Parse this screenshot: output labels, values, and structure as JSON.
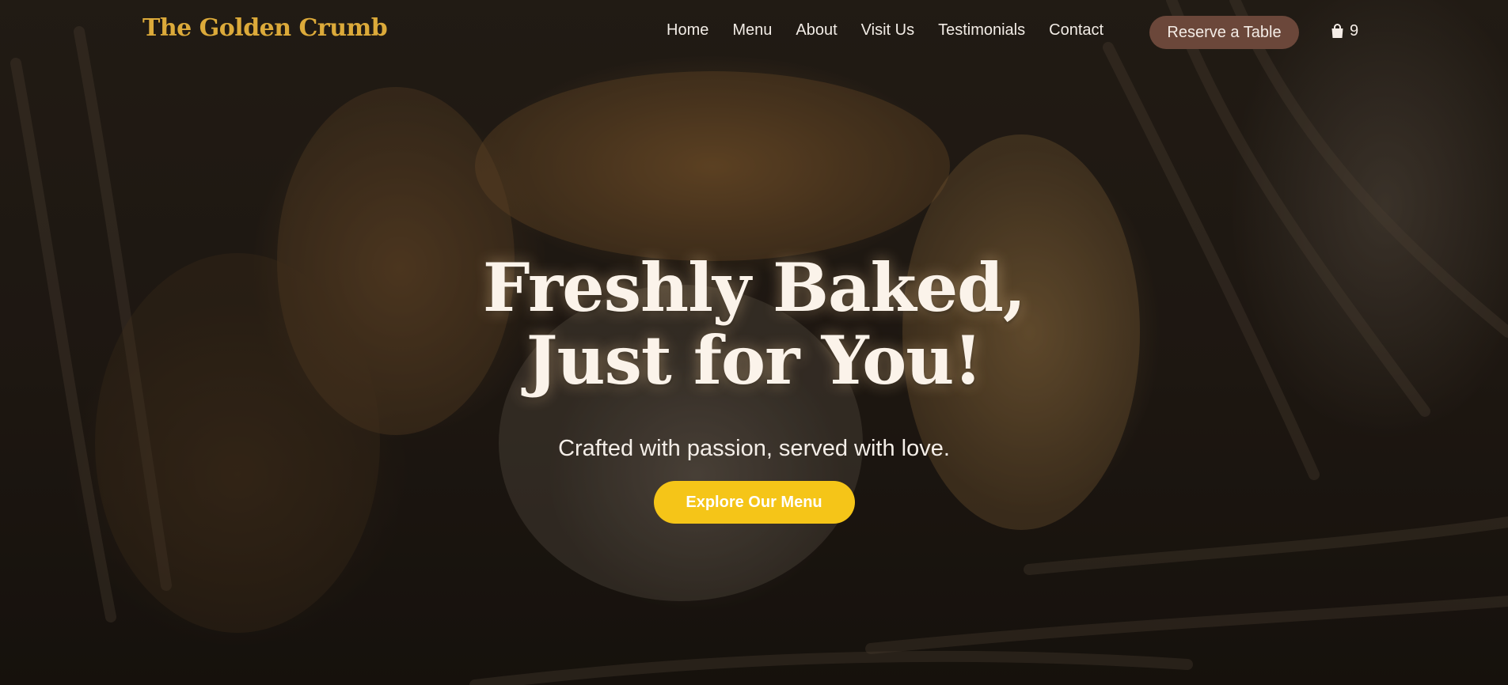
{
  "brand": {
    "name": "The Golden Crumb",
    "color": "#dcaa3a"
  },
  "nav": {
    "links": [
      "Home",
      "Menu",
      "About",
      "Visit Us",
      "Testimonials",
      "Contact"
    ],
    "reserve_label": "Reserve a Table",
    "cart": {
      "icon": "shopping-bag-icon",
      "count": "9"
    }
  },
  "hero": {
    "title_line1": "Freshly Baked,",
    "title_line2": "Just for You!",
    "subtitle": "Crafted with passion, served with love.",
    "cta_label": "Explore Our Menu",
    "background_image": "bakery-pastries-in-basket"
  },
  "colors": {
    "accent": "#f5c518",
    "reserve_button": "#6b473a",
    "text_light": "#f4eee8"
  }
}
